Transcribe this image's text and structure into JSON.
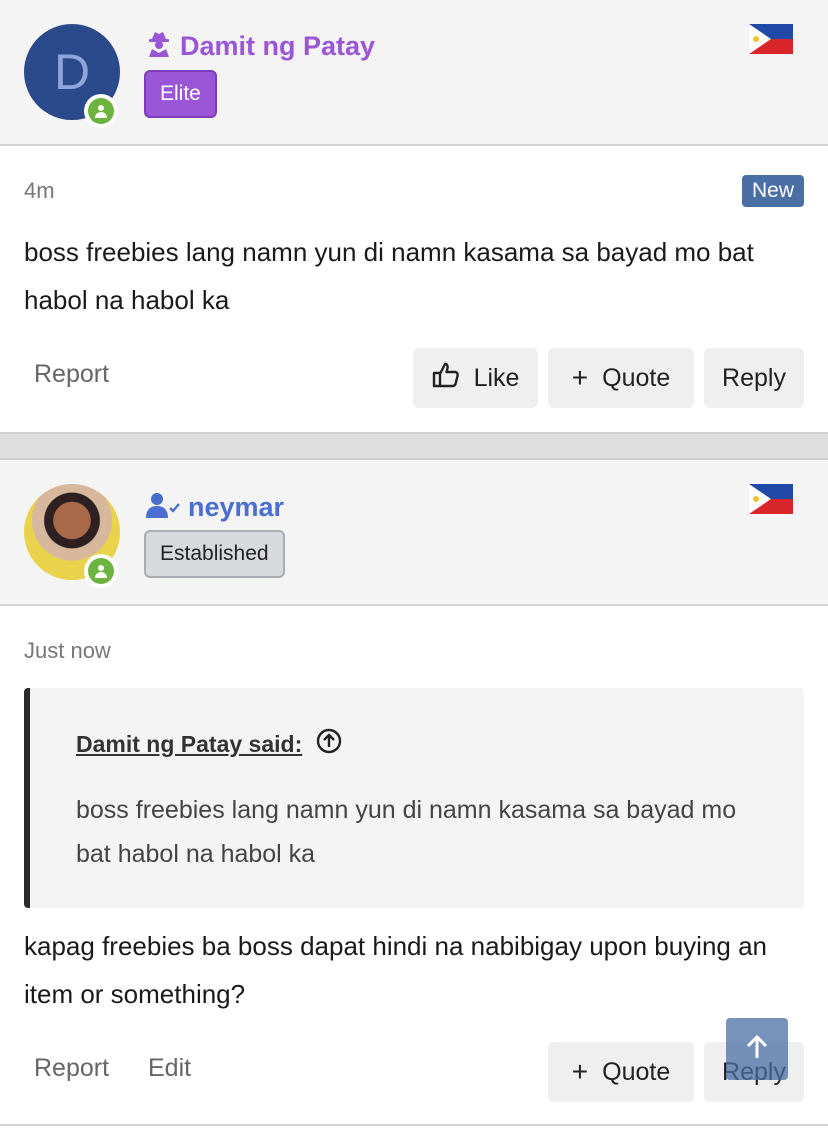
{
  "posts": [
    {
      "author": "Damit ng Patay",
      "role_badge": "Elite",
      "avatar_letter": "D",
      "time": "4m",
      "new_label": "New",
      "message": "boss freebies lang namn yun di namn kasama sa bayad mo bat habol na habol ka",
      "actions": {
        "report": "Report",
        "like": "Like",
        "quote": "Quote",
        "reply": "Reply"
      }
    },
    {
      "author": "neymar",
      "role_badge": "Established",
      "time": "Just now",
      "quote": {
        "author": "Damit ng Patay said:",
        "text": "boss freebies lang namn yun di namn kasama sa bayad mo bat habol na habol ka"
      },
      "message": "kapag freebies ba boss dapat hindi na nabibigay upon buying an item or something?",
      "actions": {
        "report": "Report",
        "edit": "Edit",
        "quote": "Quote",
        "reply": "Reply"
      }
    }
  ],
  "colors": {
    "elite": "#9a56d6",
    "established_name": "#4a6fd1",
    "new_badge": "#4a6fa5"
  },
  "icons": [
    "user-secret-icon",
    "user-check-icon",
    "philippines-flag-icon",
    "online-status-icon",
    "thumbs-up-icon",
    "plus-icon",
    "arrow-up-circle-icon",
    "arrow-up-icon"
  ]
}
